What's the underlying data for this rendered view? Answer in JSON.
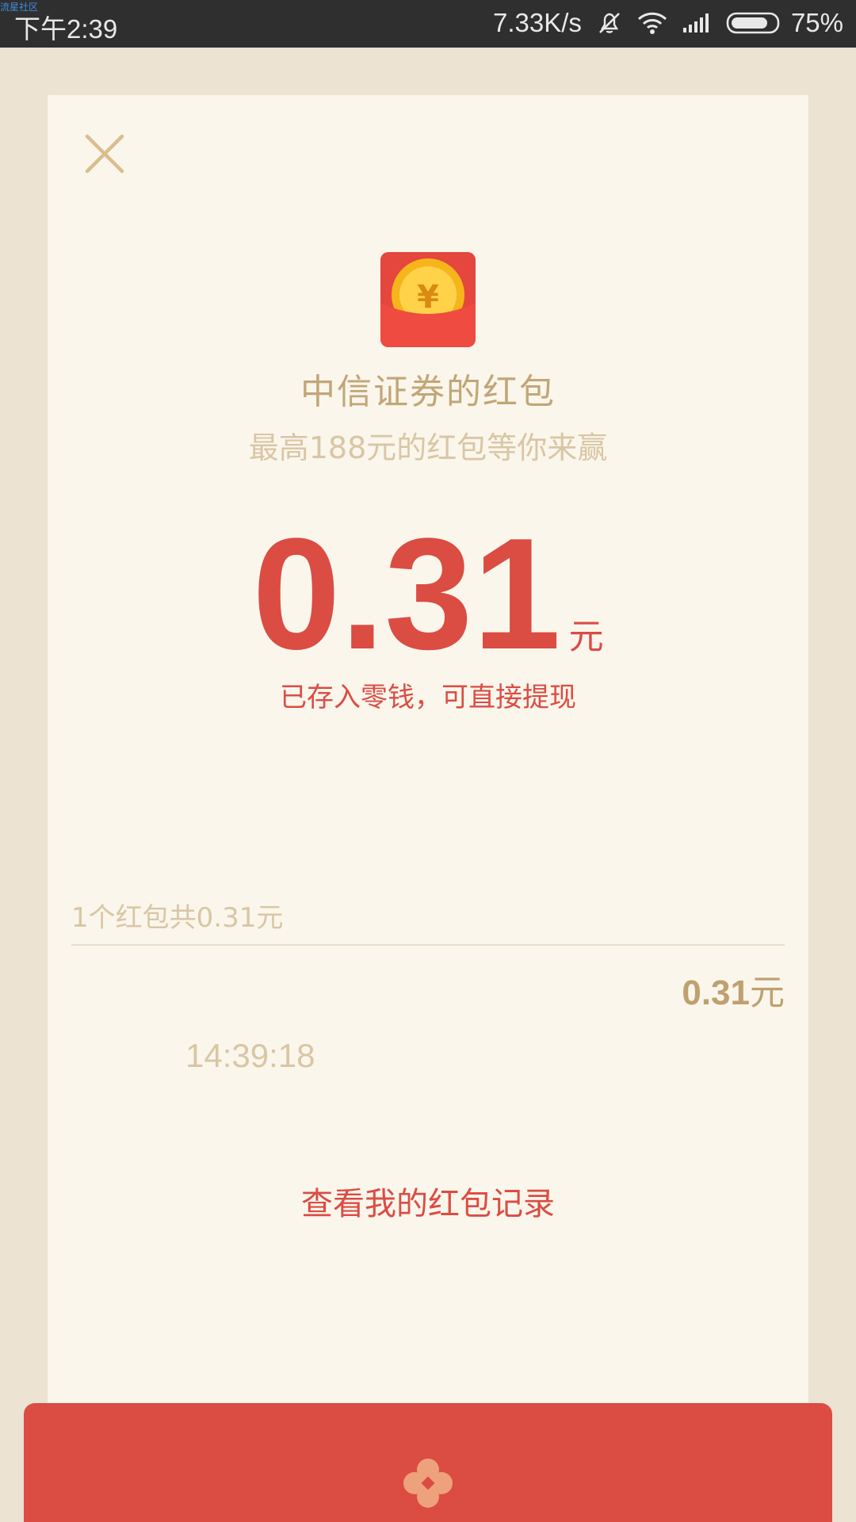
{
  "watermark": "流星社区",
  "status_bar": {
    "time": "下午2:39",
    "net_speed": "7.33K/s",
    "battery": "75%"
  },
  "card": {
    "title": "中信证券的红包",
    "subtitle": "最高188元的红包等你来赢",
    "amount": "0.31",
    "amount_unit": "元",
    "stored_note": "已存入零钱，可直接提现",
    "summary": "1个红包共0.31元",
    "entry": {
      "amount": "0.31",
      "unit": "元",
      "time": "14:39:18"
    },
    "records_link": "查看我的红包记录"
  },
  "colors": {
    "accent_red": "#DB4C43",
    "gold": "#C2A677",
    "card_bg": "#FAF6EC",
    "page_bg": "#ECE3D2"
  },
  "icons": [
    "close-icon",
    "red-packet-logo-icon",
    "mute-icon",
    "wifi-icon",
    "signal-icon",
    "battery-icon",
    "flower-icon"
  ]
}
